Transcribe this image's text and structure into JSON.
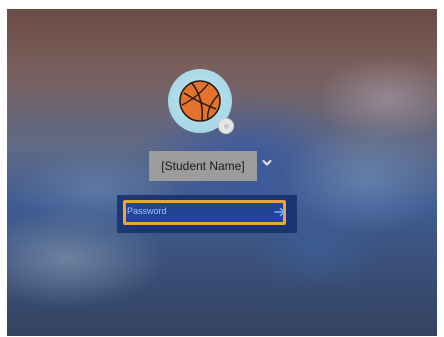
{
  "login": {
    "user_name": "[Student Name]",
    "password_placeholder": "Password",
    "avatar_icon": "basketball-icon",
    "switch_user_icon": "chevron-down-icon",
    "submit_icon": "arrow-right-icon"
  },
  "colors": {
    "focus_border": "#f2a23a",
    "field_bg": "#2346a0",
    "placeholder_text": "#9bc6ff",
    "name_box_bg": "#9c9c9c"
  }
}
